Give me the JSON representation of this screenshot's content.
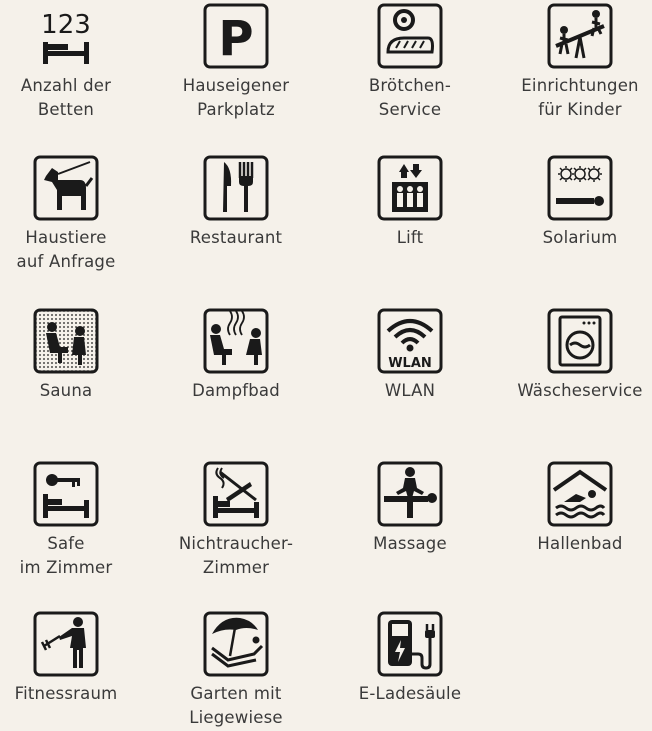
{
  "amenities": [
    {
      "label": "Anzahl der\nBetten",
      "icon": "beds-count-icon"
    },
    {
      "label": "Hauseigener\nParkplatz",
      "icon": "parking-icon"
    },
    {
      "label": "Brötchen-\nService",
      "icon": "bread-roll-service-icon"
    },
    {
      "label": "Einrichtungen\nfür Kinder",
      "icon": "children-facilities-icon"
    },
    {
      "label": "Haustiere\nauf Anfrage",
      "icon": "pets-icon"
    },
    {
      "label": "Restaurant",
      "icon": "restaurant-icon"
    },
    {
      "label": "Lift",
      "icon": "lift-icon"
    },
    {
      "label": "Solarium",
      "icon": "solarium-icon"
    },
    {
      "label": "Sauna",
      "icon": "sauna-icon"
    },
    {
      "label": "Dampfbad",
      "icon": "steam-bath-icon"
    },
    {
      "label": "WLAN",
      "icon": "wlan-icon"
    },
    {
      "label": "Wäscheservice",
      "icon": "laundry-icon"
    },
    {
      "label": "Safe\nim Zimmer",
      "icon": "room-safe-icon"
    },
    {
      "label": "Nichtraucher-\nZimmer",
      "icon": "non-smoking-room-icon"
    },
    {
      "label": "Massage",
      "icon": "massage-icon"
    },
    {
      "label": "Hallenbad",
      "icon": "indoor-pool-icon"
    },
    {
      "label": "Fitnessraum",
      "icon": "fitness-room-icon"
    },
    {
      "label": "Garten mit\nLiegewiese",
      "icon": "garden-lawn-icon"
    },
    {
      "label": "E-Ladesäule",
      "icon": "ev-charging-icon"
    }
  ],
  "icon_text": {
    "beds_number": "123",
    "parking_letter": "P",
    "wlan_text": "WLAN"
  },
  "colors": {
    "background": "#f5f1ea",
    "icon": "#1a1a1a",
    "text": "#3a3a3a"
  }
}
